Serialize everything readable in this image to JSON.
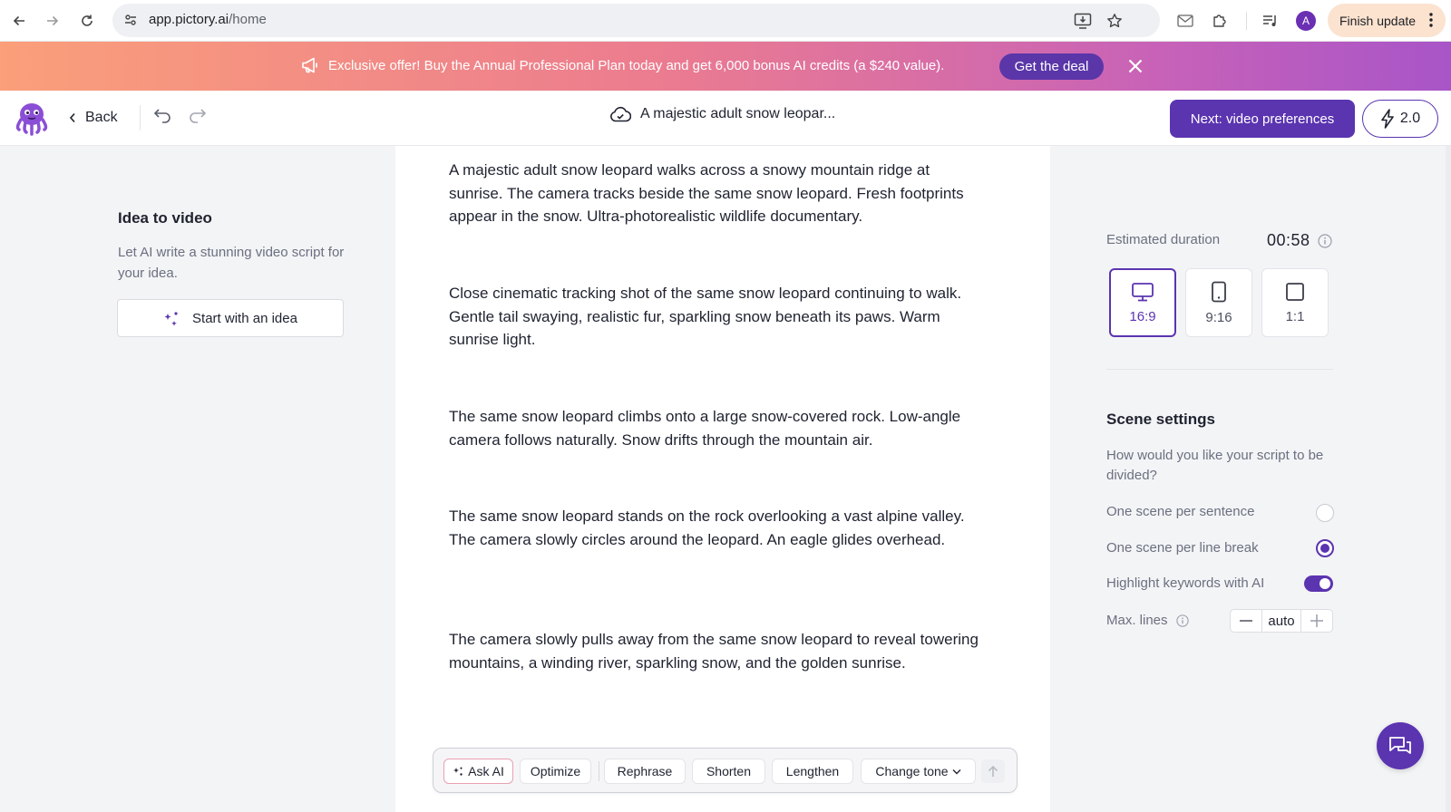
{
  "browser": {
    "url_host": "app.pictory.ai",
    "url_path": "/home",
    "profile_initial": "A",
    "finish_update_label": "Finish update"
  },
  "banner": {
    "text": "Exclusive offer! Buy the Annual Professional Plan today and get 6,000 bonus AI credits (a $240 value).",
    "cta_label": "Get the deal"
  },
  "header": {
    "back_label": "Back",
    "project_title": "A majestic adult snow leopar...",
    "next_label": "Next: video preferences",
    "credits_label": "2.0"
  },
  "left_panel": {
    "title": "Idea to video",
    "description": "Let AI write a stunning video script for your idea.",
    "button_label": "Start with an idea"
  },
  "script": {
    "paragraphs": [
      "A majestic adult snow leopard walks across a snowy mountain ridge at sunrise. The camera tracks beside the same snow leopard. Fresh footprints appear in the snow. Ultra-photorealistic wildlife documentary.",
      "Close cinematic tracking shot of the same snow leopard continuing to walk. Gentle tail swaying, realistic fur, sparkling snow beneath its paws. Warm sunrise light.",
      "The same snow leopard climbs onto a large snow-covered rock. Low-angle camera follows naturally. Snow drifts through the mountain air.",
      "The same snow leopard stands on the rock overlooking a vast alpine valley. The camera slowly circles around the leopard. An eagle glides overhead.",
      "The camera slowly pulls away from the same snow leopard to reveal towering mountains, a winding river, sparkling snow, and the golden sunrise."
    ]
  },
  "ai_toolbar": {
    "ask_ai": "Ask AI",
    "optimize": "Optimize",
    "rephrase": "Rephrase",
    "shorten": "Shorten",
    "lengthen": "Lengthen",
    "change_tone": "Change tone"
  },
  "right_panel": {
    "duration_label": "Estimated duration",
    "duration_value": "00:58",
    "ratios": [
      {
        "label": "16:9",
        "selected": true
      },
      {
        "label": "9:16",
        "selected": false
      },
      {
        "label": "1:1",
        "selected": false
      }
    ],
    "scene_title": "Scene settings",
    "scene_question": "How would you like your script to be divided?",
    "option_sentence": "One scene per sentence",
    "option_sentence_selected": false,
    "option_line_break": "One scene per line break",
    "option_line_break_selected": true,
    "highlight_keywords": "Highlight keywords with AI",
    "highlight_keywords_on": true,
    "max_lines_label": "Max. lines",
    "max_lines_value": "auto"
  },
  "colors": {
    "brand_purple": "#5b34b0",
    "banner_gradient_start": "#fa9f7a",
    "banner_gradient_end": "#a855c8"
  }
}
